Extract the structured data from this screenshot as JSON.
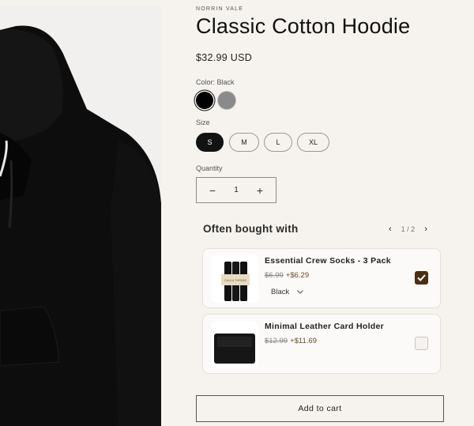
{
  "product": {
    "vendor": "NORRIN VALE",
    "title": "Classic Cotton Hoodie",
    "price": "$32.99 USD"
  },
  "color": {
    "label": "Color: ",
    "selected": "Black",
    "swatches": [
      {
        "name": "Black",
        "hex": "#000000"
      },
      {
        "name": "Grey",
        "hex": "#8a8a8a"
      }
    ]
  },
  "size": {
    "label": "Size",
    "options": [
      "S",
      "M",
      "L",
      "XL"
    ],
    "selected": "S"
  },
  "quantity": {
    "label": "Quantity",
    "value": "1",
    "minus": "−",
    "plus": "+"
  },
  "upsell": {
    "heading": "Often bought with",
    "pager": "1 / 2",
    "prev_icon": "‹",
    "next_icon": "›",
    "items": [
      {
        "name": "Essential Crew Socks - 3 Pack",
        "old_price": "$6.99",
        "new_price": "+$6.29",
        "variant": "Black",
        "checked": true,
        "thumb_label": "CALA & THREAD"
      },
      {
        "name": "Minimal Leather Card Holder",
        "old_price": "$12.99",
        "new_price": "+$11.69",
        "checked": false
      }
    ]
  },
  "cart": {
    "label": "Add to cart"
  },
  "colors": {
    "background": "#f6f3ee",
    "accent_checkbox": "#4a2f14",
    "sale_price": "#6b4a22"
  }
}
